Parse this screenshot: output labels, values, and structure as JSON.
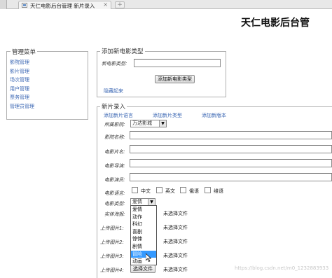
{
  "browser": {
    "tab_title": "天仁电影后台管理 新片录入",
    "tab_close": "×",
    "new_tab": "+"
  },
  "header": {
    "site_title": "天仁电影后台管"
  },
  "menu": {
    "legend": "管理菜单",
    "items": [
      "影院管理",
      "影片管理",
      "场次管理",
      "用户管理",
      "票务管理",
      "管理员管理"
    ]
  },
  "add_type": {
    "legend": "添加新电影类型",
    "name_label": "新电影类型:",
    "name_value": "",
    "submit": "添加新电影类型",
    "hide_link": "隐藏起来"
  },
  "new_movie": {
    "legend": "新片录入",
    "links": [
      "添加新片语言",
      "添加新片类型",
      "添加新版本"
    ],
    "cinema_label": "所属影院:",
    "cinema_value": "万达影城",
    "name_label": "影院名称:",
    "title_label": "电影片名:",
    "director_label": "电影导演:",
    "actor_label": "电影演员:",
    "language_label": "电影语言:",
    "languages": [
      "中文",
      "英文",
      "俄语",
      "维语"
    ],
    "type_label": "电影类型:",
    "type_value": "爱情",
    "poster_label": "实体海报:",
    "pic1_label": "上传图片1:",
    "pic2_label": "上传图片2:",
    "pic3_label": "上传图片3:",
    "pic4_label": "上传图片4:",
    "choose_file": "选择文件",
    "no_file": "未选择文件",
    "type_options": [
      "爱情",
      "动作",
      "科幻",
      "喜剧",
      "惊悚",
      "剧情",
      "冒险",
      "动画"
    ],
    "type_highlight": "冒险"
  },
  "watermark": "https://blog.csdn.net/m0_1232883933"
}
